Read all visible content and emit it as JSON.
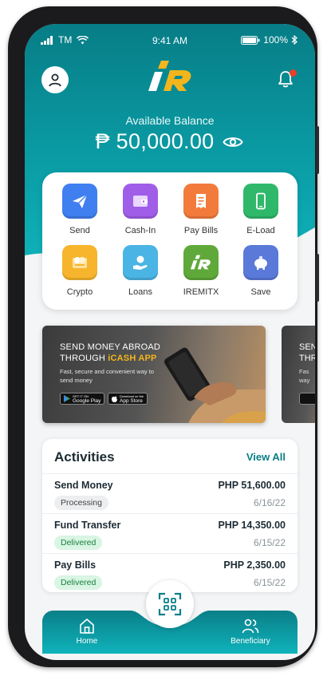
{
  "status_bar": {
    "carrier": "TM",
    "time": "9:41 AM",
    "battery": "100%"
  },
  "header": {
    "balance_label": "Available Balance",
    "balance_amount": "₱ 50,000.00"
  },
  "quick_actions": [
    {
      "label": "Send",
      "icon": "paper-plane-icon",
      "color": "#3f7ff0"
    },
    {
      "label": "Cash-In",
      "icon": "wallet-icon",
      "color": "#a05de8"
    },
    {
      "label": "Pay Bills",
      "icon": "receipt-icon",
      "color": "#f27b3c"
    },
    {
      "label": "E-Load",
      "icon": "mobile-phone-icon",
      "color": "#2fb86a"
    },
    {
      "label": "Crypto",
      "icon": "crypto-coins-icon",
      "color": "#f6b52c"
    },
    {
      "label": "Loans",
      "icon": "hand-coin-icon",
      "color": "#4ab4e4"
    },
    {
      "label": "IREMITX",
      "icon": "iremitx-logo-icon",
      "color": "#5fa93a"
    },
    {
      "label": "Save",
      "icon": "piggy-bank-icon",
      "color": "#5a79d8"
    }
  ],
  "banner": {
    "line1": "SEND MONEY ABROAD",
    "line2_prefix": "THROUGH ",
    "line2_accent": "iCASH APP",
    "sub": "Fast, secure and convenient way to send money",
    "google_play_small": "GET IT ON",
    "google_play": "Google Play",
    "app_store_small": "Download on the",
    "app_store": "App Store"
  },
  "banner_peek": {
    "line1": "SEN",
    "line2": "THR",
    "sub1": "Fas",
    "sub2": "way"
  },
  "activities": {
    "title": "Activities",
    "view_all": "View All",
    "items": [
      {
        "name": "Send Money",
        "amount": "PHP 51,600.00",
        "status": "Processing",
        "date": "6/16/22"
      },
      {
        "name": "Fund Transfer",
        "amount": "PHP 14,350.00",
        "status": "Delivered",
        "date": "6/15/22"
      },
      {
        "name": "Pay Bills",
        "amount": "PHP 2,350.00",
        "status": "Delivered",
        "date": "6/15/22"
      }
    ]
  },
  "bottom_nav": {
    "home": "Home",
    "beneficiary": "Beneficiary"
  },
  "colors": {
    "primary": "#0a8f98",
    "accent": "#f3b51c",
    "notification": "#e8402a"
  }
}
